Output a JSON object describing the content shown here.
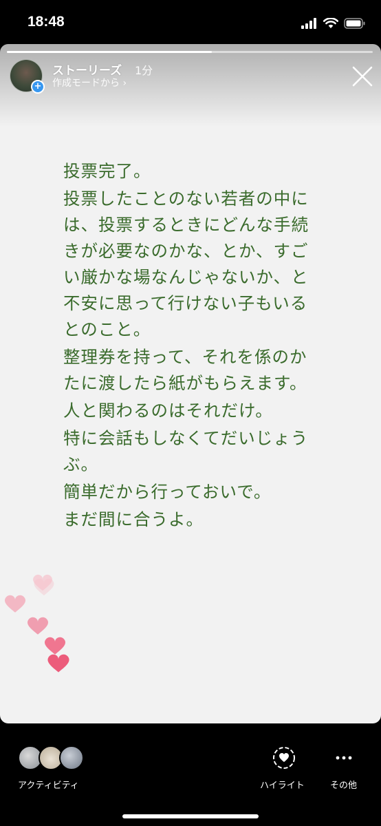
{
  "status_bar": {
    "time": "18:48",
    "icons": [
      "cellular-signal-icon",
      "wifi-icon",
      "battery-icon"
    ]
  },
  "story": {
    "progress": 0.56,
    "user_name": "ストーリーズ",
    "time_ago": "1分",
    "subtitle": "作成モードから ›",
    "text_color": "#3a6b2c",
    "background_color": "#f2f2f2",
    "paragraphs": [
      "投票完了。",
      "投票したことのない若者の中には、投票するときにどんな手続きが必要なのかな、とか、すごい厳かな場なんじゃないか、と不安に思って行けない子もいるとのこと。",
      "整理券を持って、それを係のかたに渡したら紙がもらえます。",
      "人と関わるのはそれだけ。",
      "特に会話もしなくてだいじょうぶ。",
      "簡単だから行っておいで。",
      "まだ間に合うよ。"
    ],
    "heart_color": "#f06b87"
  },
  "bottom_bar": {
    "activity_label": "アクティビティ",
    "highlight_label": "ハイライト",
    "more_label": "その他"
  }
}
